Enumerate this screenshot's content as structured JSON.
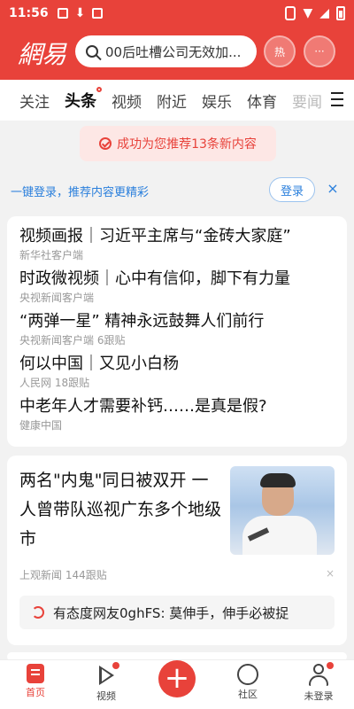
{
  "status": {
    "time": "11:56"
  },
  "header": {
    "logo": "網易",
    "search_placeholder": "00后吐槽公司无效加...",
    "hot_label": "热",
    "message_label": "···"
  },
  "tabs": [
    "关注",
    "头条",
    "视频",
    "附近",
    "娱乐",
    "体育",
    "要闻"
  ],
  "active_tab": "头条",
  "toast": "成功为您推荐13条新内容",
  "login": {
    "text": "一键登录，推荐内容更精彩",
    "button": "登录",
    "close": "×"
  },
  "feed": {
    "headlines": [
      {
        "title": "视频画报｜习近平主席与“金砖大家庭”",
        "meta": "新华社客户端"
      },
      {
        "title": "时政微视频｜心中有信仰，脚下有力量",
        "meta": "央视新闻客户端"
      },
      {
        "title": "“两弹一星” 精神永远鼓舞人们前行",
        "meta": "央视新闻客户端   6跟贴"
      },
      {
        "title": "何以中国｜又见小白杨",
        "meta": "人民网   18跟贴"
      },
      {
        "title": "中老年人才需要补钙……是真是假?",
        "meta": "健康中国"
      }
    ],
    "article": {
      "title": "两名\"内鬼\"同日被双开 一人曾带队巡视广东多个地级市",
      "meta": "上观新闻   144跟贴",
      "close": "×",
      "comment": "有态度网友0ghFS: 莫伸手，伸手必被捉"
    }
  },
  "bottom_nav": [
    {
      "label": "首页"
    },
    {
      "label": "视频"
    },
    {
      "label": "+"
    },
    {
      "label": "社区"
    },
    {
      "label": "未登录"
    }
  ],
  "colors": {
    "brand_red": "#e8423a",
    "link_blue": "#2a7fdc"
  }
}
